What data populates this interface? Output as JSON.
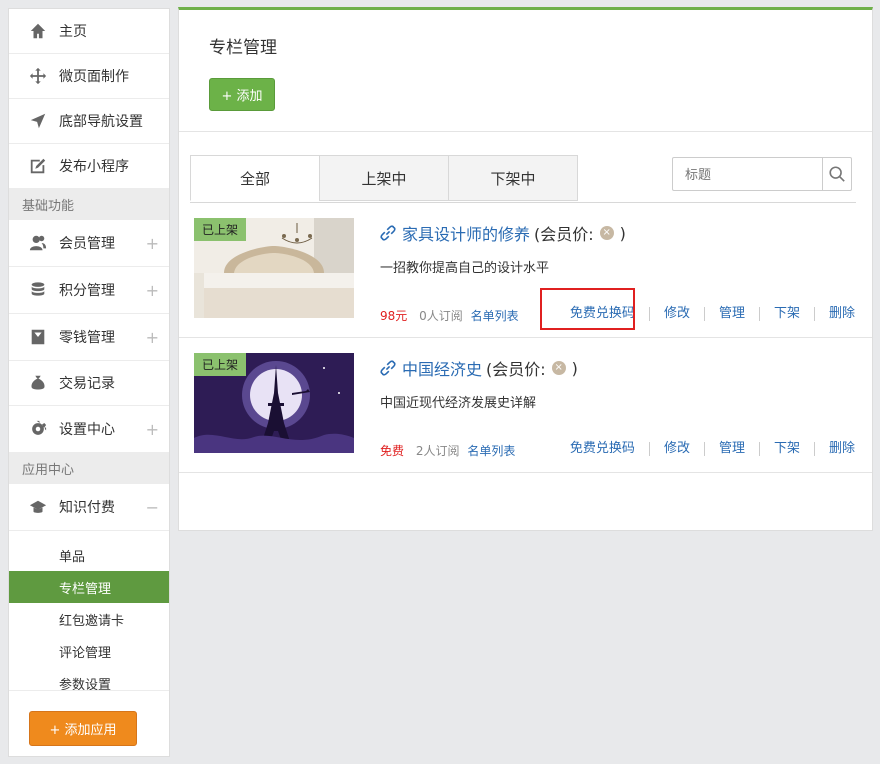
{
  "sidebar": {
    "items_top": [
      {
        "label": "主页",
        "icon": "home-icon"
      },
      {
        "label": "微页面制作",
        "icon": "move-icon"
      },
      {
        "label": "底部导航设置",
        "icon": "navigation-icon"
      },
      {
        "label": "发布小程序",
        "icon": "edit-icon"
      }
    ],
    "section_basic": "基础功能",
    "items_basic": [
      {
        "label": "会员管理",
        "icon": "users-icon",
        "expander": "+"
      },
      {
        "label": "积分管理",
        "icon": "database-icon",
        "expander": "+"
      },
      {
        "label": "零钱管理",
        "icon": "wallet-icon",
        "expander": "+"
      },
      {
        "label": "交易记录",
        "icon": "money-bag-icon"
      },
      {
        "label": "设置中心",
        "icon": "gear-icon",
        "expander": "+"
      }
    ],
    "section_app": "应用中心",
    "knowledge": {
      "label": "知识付费",
      "icon": "graduation-cap-icon",
      "expander": "−"
    },
    "sub_items": [
      "单品",
      "专栏管理",
      "红包邀请卡",
      "评论管理",
      "参数设置"
    ],
    "add_app": "+ 添加应用"
  },
  "main": {
    "title": "专栏管理",
    "add_button": "+ 添加",
    "tabs": [
      "全部",
      "上架中",
      "下架中"
    ],
    "search_placeholder": "标题",
    "columns": [
      {
        "badge": "已上架",
        "title": "家具设计师的修养",
        "member_price": "(会员价:",
        "close_paren": ")",
        "desc": "一招教你提高自己的设计水平",
        "price": "98元",
        "subs": "0人订阅",
        "namelist": "名单列表"
      },
      {
        "badge": "已上架",
        "title": "中国经济史",
        "member_price": "(会员价:",
        "close_paren": ")",
        "desc": "中国近现代经济发展史详解",
        "price": "免费",
        "subs": "2人订阅",
        "namelist": "名单列表"
      }
    ],
    "actions": [
      "免费兑换码",
      "修改",
      "管理",
      "下架",
      "删除"
    ]
  },
  "colors": {
    "accent_green": "#5f9a40",
    "add_orange": "#ef8a1d",
    "link_blue": "#2a6bb3",
    "price_red": "#e02020"
  }
}
